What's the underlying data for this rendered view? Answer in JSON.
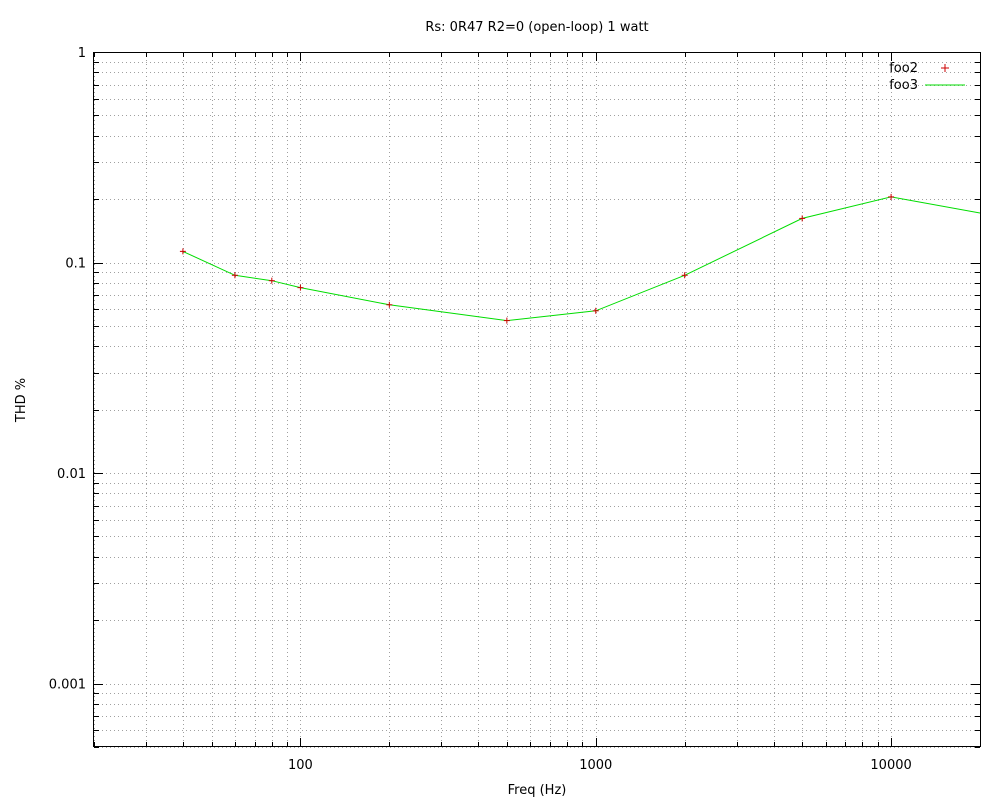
{
  "chart_data": {
    "type": "line",
    "title": "Rs: 0R47  R2=0 (open-loop) 1 watt",
    "xlabel": "Freq (Hz)",
    "ylabel": "THD %",
    "x_scale": "log",
    "y_scale": "log",
    "xlim": [
      20,
      20000
    ],
    "ylim": [
      0.0005,
      1
    ],
    "grid": true,
    "legend_position": "top-right",
    "x_ticks": [
      {
        "value": 100,
        "label": "100"
      },
      {
        "value": 1000,
        "label": "1000"
      },
      {
        "value": 10000,
        "label": "10000"
      }
    ],
    "y_ticks": [
      {
        "value": 1,
        "label": "1"
      },
      {
        "value": 0.1,
        "label": "0.1"
      },
      {
        "value": 0.01,
        "label": "0.01"
      },
      {
        "value": 0.001,
        "label": "0.001"
      }
    ],
    "series": [
      {
        "name": "foo2",
        "style": "points",
        "marker": "+",
        "color": "#cc0000",
        "x": [
          40,
          60,
          80,
          100,
          200,
          500,
          1000,
          2000,
          5000,
          10000
        ],
        "y": [
          0.113,
          0.087,
          0.082,
          0.076,
          0.063,
          0.053,
          0.059,
          0.087,
          0.162,
          0.205
        ]
      },
      {
        "name": "foo3",
        "style": "line",
        "color": "#00dd00",
        "x": [
          40,
          60,
          80,
          100,
          200,
          500,
          1000,
          2000,
          5000,
          10000,
          20000
        ],
        "y": [
          0.113,
          0.087,
          0.082,
          0.076,
          0.063,
          0.053,
          0.059,
          0.087,
          0.162,
          0.205,
          0.172
        ]
      }
    ]
  }
}
